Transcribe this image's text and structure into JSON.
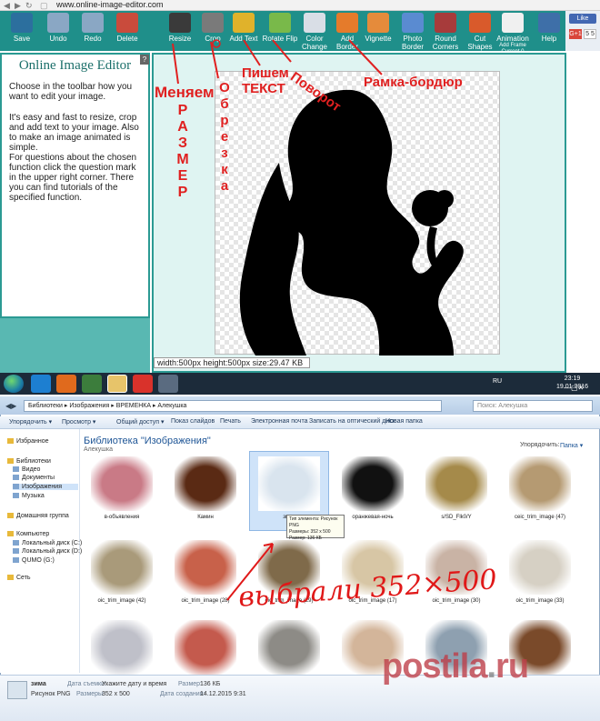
{
  "browser": {
    "url": "www.online-image-editor.com",
    "colors": {
      "toolbar": "#1f8f8a",
      "panel_border": "#2b9a93",
      "annotation": "#e02020"
    }
  },
  "toolbar": {
    "buttons": [
      {
        "label": "Save",
        "icon": "floppy-icon"
      },
      {
        "label": "Undo",
        "icon": "undo-icon"
      },
      {
        "label": "Redo",
        "icon": "redo-icon"
      },
      {
        "label": "Delete",
        "icon": "delete-icon"
      },
      {
        "label": "Resize",
        "icon": "resize-icon"
      },
      {
        "label": "Crop",
        "icon": "crop-icon"
      },
      {
        "label": "Add Text",
        "icon": "text-icon"
      },
      {
        "label": "Rotate Flip",
        "icon": "rotate-icon"
      },
      {
        "label": "Color Change",
        "icon": "palette-icon"
      },
      {
        "label": "Add Border",
        "icon": "border-icon"
      },
      {
        "label": "Vignette",
        "icon": "vignette-icon"
      },
      {
        "label": "Photo Border",
        "icon": "photo-border-icon"
      },
      {
        "label": "Round Corners",
        "icon": "round-corners-icon"
      },
      {
        "label": "Cut Shapes",
        "icon": "cut-shapes-icon"
      },
      {
        "label": "Animation",
        "sub": "Add Frame Current 0",
        "icon": "animation-icon"
      },
      {
        "label": "Help",
        "icon": "help-icon"
      }
    ],
    "social": {
      "like": "Like",
      "gplus": "G+1",
      "count": "5 5"
    }
  },
  "side_panel": {
    "title": "Online Image Editor",
    "help": "?",
    "paragraphs": [
      "Choose in the toolbar how you want to edit your image.",
      "It's easy and fast to resize, crop and add text to your image. Also to make an image animated is simple.",
      "For questions about the chosen function click the question mark in the upper right corner. There you can find tutorials of the specified function."
    ]
  },
  "canvas": {
    "status": "width:500px  height:500px  size:29.47 KB"
  },
  "annotations": {
    "resize_word": "Меняем",
    "resize_vertical": [
      "Р",
      "А",
      "З",
      "М",
      "Е",
      "Р"
    ],
    "crop_vertical": [
      "О",
      "б",
      "р",
      "е",
      "з",
      "к",
      "а"
    ],
    "text_label": "Пишем ТЕКСТ",
    "rotate_label": "Поворот",
    "border_label": "Рамка-бордюр",
    "chosen_label": "выбрали 352×500"
  },
  "taskbar": {
    "lang": "RU",
    "time": "23:19",
    "date": "19.01.2016"
  },
  "explorer": {
    "breadcrumb": "Библиотеки ▸ Изображения ▸ ВРЕМЕНКА ▸ Алекушка",
    "search_placeholder": "Поиск: Алекушка",
    "commands": [
      "Упорядочить ▾",
      "Просмотр ▾",
      "Общий доступ ▾",
      "Показ слайдов",
      "Печать",
      "Электронная почта",
      "Записать на оптический диск",
      "Новая папка"
    ],
    "nav": [
      {
        "label": "Избранное",
        "group": true
      },
      {
        "label": "Библиотеки",
        "group": true
      },
      {
        "label": "Видео"
      },
      {
        "label": "Документы"
      },
      {
        "label": "Изображения",
        "selected": true
      },
      {
        "label": "Музыка"
      },
      {
        "label": "Домашняя группа",
        "group": true
      },
      {
        "label": "Компьютер",
        "group": true
      },
      {
        "label": "Локальный диск (C:)"
      },
      {
        "label": "Локальный диск (D:)"
      },
      {
        "label": "QUMO (G:)"
      },
      {
        "label": "Сеть",
        "group": true
      }
    ],
    "library_title": "Библиотека \"Изображения\"",
    "library_sub": "Алекушка",
    "arrange_label": "Упорядочить:",
    "arrange_value": "Папка ▾",
    "items": [
      {
        "label": "в-объявления",
        "color": "#c97a86"
      },
      {
        "label": "Камин",
        "color": "#5a2a14"
      },
      {
        "label": "зима",
        "color": "#d9e4ee",
        "selected": true
      },
      {
        "label": "оранжевая-ночь",
        "color": "#111111"
      },
      {
        "label": "s/SD_Flk0/Y",
        "color": "#a58a4a"
      },
      {
        "label": "ceic_trim_image (47)",
        "color": "#b59a72"
      },
      {
        "label": "oic_trim_image (42)",
        "color": "#a99a7a"
      },
      {
        "label": "oic_trim_image (28)",
        "color": "#c8614a"
      },
      {
        "label": "oic_trim_image (29)",
        "color": "#7f6a4a"
      },
      {
        "label": "oic_trim_image (17)",
        "color": "#d7c6a5"
      },
      {
        "label": "oic_trim_image (30)",
        "color": "#c9b3a5"
      },
      {
        "label": "oic_trim_image (33)",
        "color": "#d6d0c4"
      },
      {
        "label": "",
        "color": "#bfc0c9"
      },
      {
        "label": "",
        "color": "#c45a4d"
      },
      {
        "label": "",
        "color": "#8d8b86"
      },
      {
        "label": "",
        "color": "#d3b59a"
      },
      {
        "label": "",
        "color": "#8ea0b0"
      },
      {
        "label": "",
        "color": "#7a4a2a"
      }
    ],
    "tooltip": [
      "Тип элемента: Рисунок PNG",
      "Размеры: 352 x 500",
      "Размер: 136 КБ"
    ]
  },
  "details": {
    "name": "зима",
    "type": "Рисунок PNG",
    "taken_key": "Дата съемки:",
    "taken_val": "Укажите дату и время",
    "dims_key": "Размеры:",
    "dims_val": "352 x 500",
    "size_key": "Размер:",
    "size_val": "136 КБ",
    "created_key": "Дата создания:",
    "created_val": "14.12.2015 9:31"
  },
  "watermark": {
    "main": "postila",
    "dot": ".",
    "tld": "ru"
  }
}
